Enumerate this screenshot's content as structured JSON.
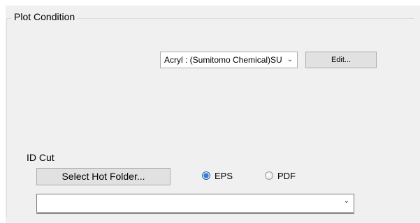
{
  "plot_condition": {
    "title": "Plot Condition",
    "material_select": {
      "value": "Acryl : (Sumitomo Chemical)SU",
      "dropdown_icon": "chevron-down-icon"
    },
    "edit_button": "Edit..."
  },
  "id_cut": {
    "label": "ID Cut",
    "select_hot_folder_button": "Select Hot Folder...",
    "format_options": [
      {
        "label": "EPS",
        "selected": true
      },
      {
        "label": "PDF",
        "selected": false
      }
    ],
    "folder_combo": {
      "value": "",
      "dropdown_icon": "chevron-down-icon"
    }
  },
  "colors": {
    "panel_bg": "#f0f0f0",
    "button_bg": "#e1e1e1",
    "radio_accent": "#2a6fc4"
  }
}
